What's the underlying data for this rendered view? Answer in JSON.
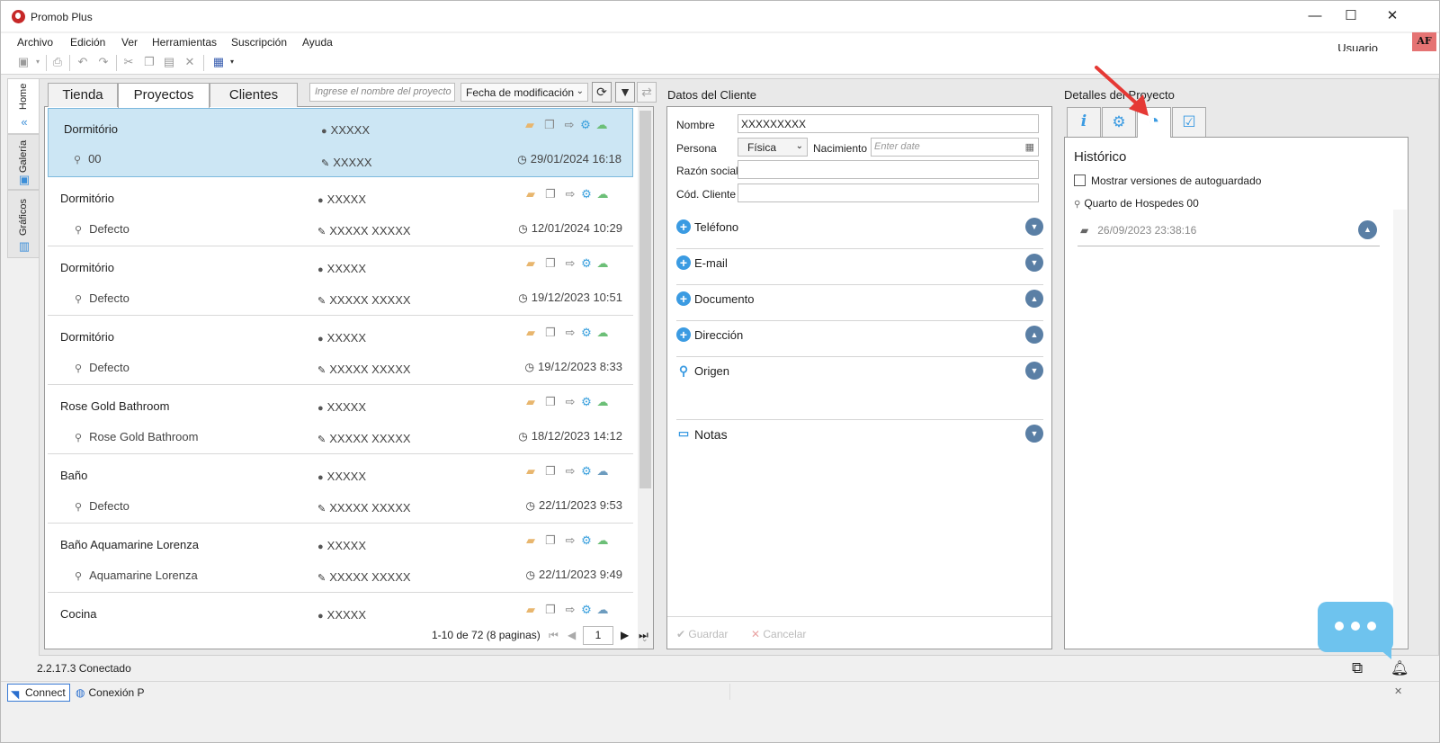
{
  "window": {
    "title": "Promob Plus",
    "minimize": "—",
    "maximize": "☐",
    "close": "✕"
  },
  "menu": [
    "Archivo",
    "Edición",
    "Ver",
    "Herramientas",
    "Suscripción",
    "Ayuda"
  ],
  "user": {
    "label": "Usuario",
    "initials": "AF"
  },
  "side_tabs": [
    {
      "label": "Home",
      "icon": "home-chevron-icon"
    },
    {
      "label": "Galería",
      "icon": "gallery-icon"
    },
    {
      "label": "Gráficos",
      "icon": "charts-icon"
    }
  ],
  "projects_panel": {
    "tabs": [
      "Tienda",
      "Proyectos",
      "Clientes"
    ],
    "active_tab": "Proyectos",
    "search_placeholder": "Ingrese el nombre del proyecto",
    "sort_value": "Fecha de modificación",
    "items": [
      {
        "name": "Dormitório",
        "version": "00",
        "owner": "XXXXX",
        "designer": "XXXXX",
        "date": "29/01/2024 16:18",
        "cloud": "green"
      },
      {
        "name": "Dormitório",
        "version": "Defecto",
        "owner": "XXXXX",
        "designer": "XXXXX XXXXX",
        "date": "12/01/2024 10:29",
        "cloud": "green"
      },
      {
        "name": "Dormitório",
        "version": "Defecto",
        "owner": "XXXXX",
        "designer": "XXXXX XXXXX",
        "date": "19/12/2023 10:51",
        "cloud": "green"
      },
      {
        "name": "Dormitório",
        "version": "Defecto",
        "owner": "XXXXX",
        "designer": "XXXXX XXXXX",
        "date": "19/12/2023 8:33",
        "cloud": "green"
      },
      {
        "name": "Rose Gold Bathroom",
        "version": "Rose Gold Bathroom",
        "owner": "XXXXX",
        "designer": "XXXXX XXXXX",
        "date": "18/12/2023 14:12",
        "cloud": "green"
      },
      {
        "name": "Baño",
        "version": "Defecto",
        "owner": "XXXXX",
        "designer": "XXXXX XXXXX",
        "date": "22/11/2023 9:53",
        "cloud": "blue"
      },
      {
        "name": "Baño Aquamarine Lorenza",
        "version": "Aquamarine Lorenza",
        "owner": "XXXXX",
        "designer": "XXXXX XXXXX",
        "date": "22/11/2023 9:49",
        "cloud": "green"
      },
      {
        "name": "Cocina",
        "version": "",
        "owner": "XXXXX",
        "designer": "",
        "date": "",
        "cloud": "blue"
      }
    ],
    "pager_text": "1-10 de 72 (8 paginas)",
    "page": "1"
  },
  "client_panel": {
    "title": "Datos del Cliente",
    "nombre_label": "Nombre",
    "nombre_value": "XXXXXXXXX",
    "persona_label": "Persona",
    "persona_value": "Física",
    "nacimiento_label": "Nacimiento",
    "nacimiento_placeholder": "Enter date",
    "razon_label": "Razón social",
    "cod_label": "Cód. Cliente",
    "sections": [
      "Teléfono",
      "E-mail",
      "Documento",
      "Dirección",
      "Origen"
    ],
    "notas": "Notas",
    "guardar": "Guardar",
    "cancelar": "Cancelar"
  },
  "details_panel": {
    "title": "Detalles del Proyecto",
    "heading": "Histórico",
    "autosave_label": "Mostrar versiones de autoguardado",
    "version_name": "Quarto de Hospedes 00",
    "history_date": "26/09/2023 23:38:16"
  },
  "status": {
    "version_text": "2.2.17.3  Conectado",
    "connect_label": "Connect",
    "conexion_label": "Conexión P"
  },
  "colors": {
    "accent": "#3b9be2",
    "selected_row": "#cce6f4",
    "arrow": "#e53935"
  }
}
